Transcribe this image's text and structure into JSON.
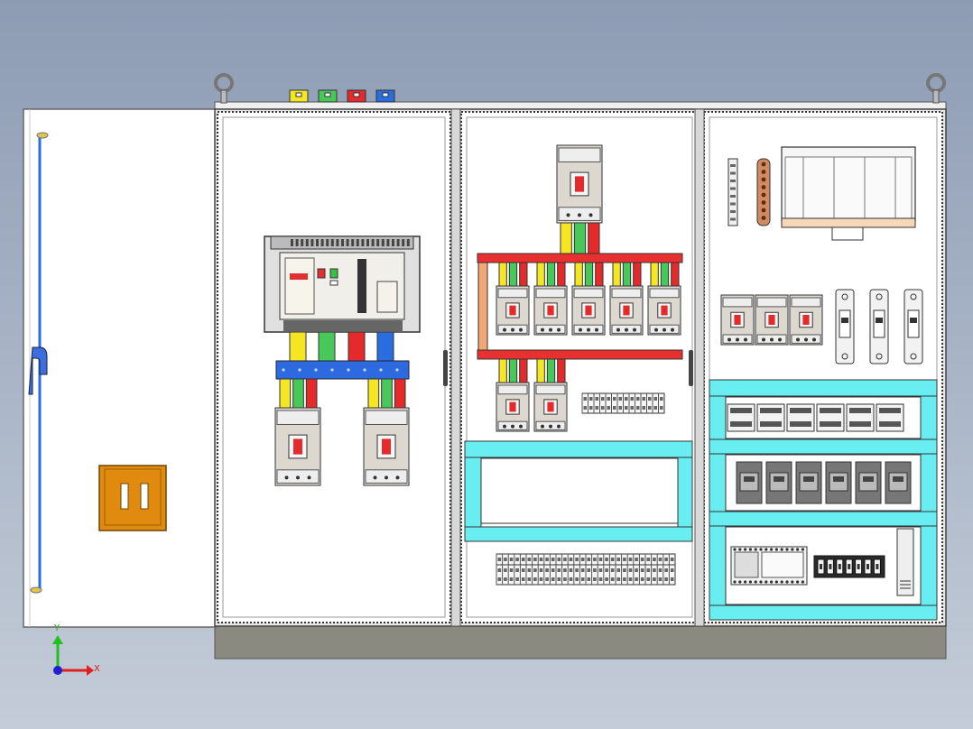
{
  "colors": {
    "background_top": "#8d9cb4",
    "background_bottom": "#c4ccd8",
    "cabinet_panel": "#ffffff",
    "cabinet_frame": "#e8e8e8",
    "plinth": "#8a8a80",
    "phase_l1": "#f4e623",
    "phase_l2": "#49c85a",
    "phase_l3": "#e42a2a",
    "neutral": "#2a6de0",
    "busbar_horizontal": "#e83030",
    "busbar_blue": "#2d6ae0",
    "din_rail_cyan": "#68eef0",
    "breaker_body": "#dcd8d0",
    "socket_orange": "#e08a10",
    "axis_x": "#e02020",
    "axis_y": "#20c020",
    "axis_origin": "#2020d0"
  },
  "phase_markers": [
    {
      "name": "l1",
      "color": "#f4e623"
    },
    {
      "name": "l2",
      "color": "#49c85a"
    },
    {
      "name": "l3",
      "color": "#e42a2a"
    },
    {
      "name": "n",
      "color": "#2a6de0"
    }
  ],
  "axes": {
    "x_label": "X",
    "y_label": "Y"
  },
  "counts": {
    "feeder_breakers_row": 5,
    "lower_feeder_breakers": 2,
    "right_small_breakers": 3,
    "fuse_holders": 3,
    "modules_row_a": 6,
    "modules_row_b": 6,
    "relay_terminals": 7
  }
}
